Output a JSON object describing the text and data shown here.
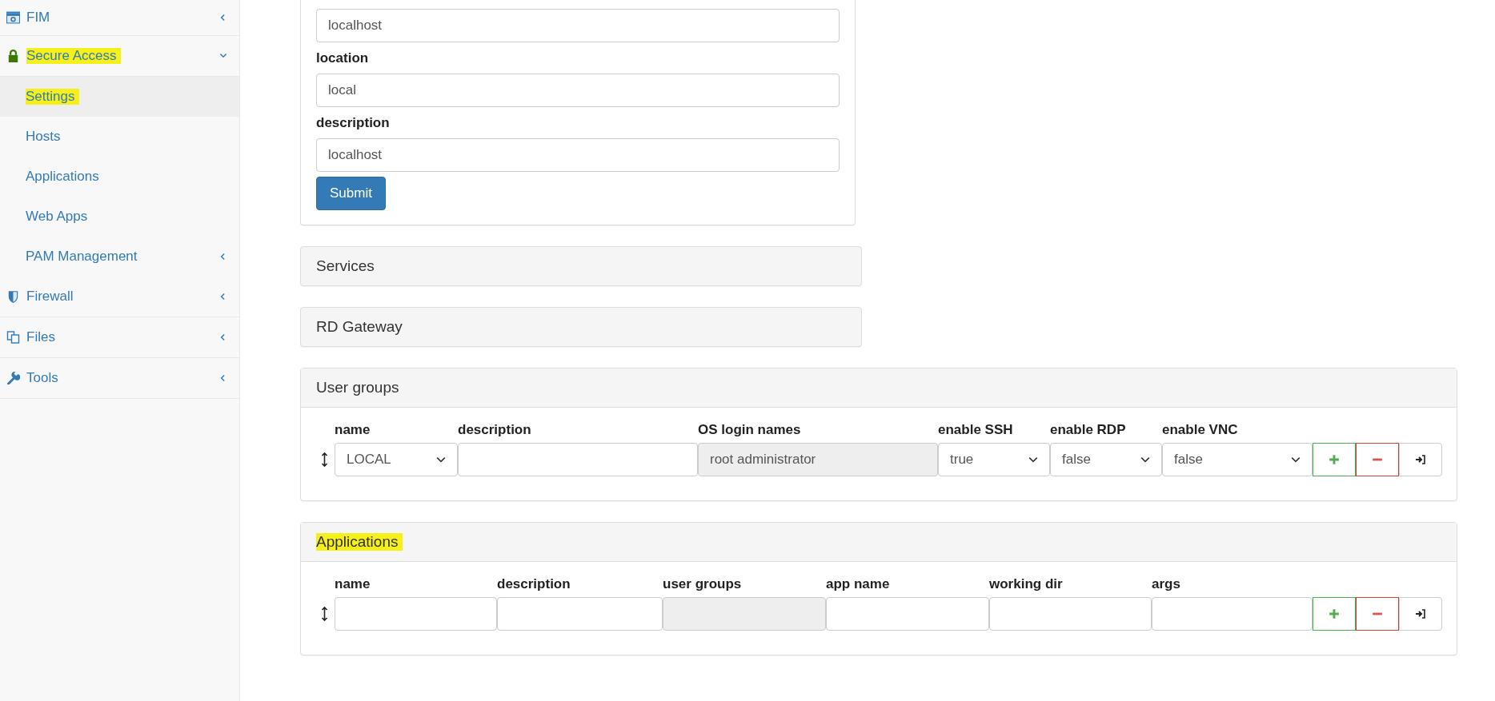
{
  "sidebar": {
    "items": [
      {
        "label": "FIM",
        "expanded": false,
        "highlighted": false
      },
      {
        "label": "Secure Access",
        "expanded": true,
        "highlighted": true,
        "children": [
          {
            "label": "Settings",
            "selected": true,
            "highlighted": true
          },
          {
            "label": "Hosts",
            "selected": false,
            "highlighted": false
          },
          {
            "label": "Applications",
            "selected": false,
            "highlighted": false
          },
          {
            "label": "Web Apps",
            "selected": false,
            "highlighted": false
          },
          {
            "label": "PAM Management",
            "selected": false,
            "highlighted": false,
            "expanded": false
          }
        ]
      },
      {
        "label": "Firewall",
        "expanded": false,
        "highlighted": false
      },
      {
        "label": "Files",
        "expanded": false,
        "highlighted": false
      },
      {
        "label": "Tools",
        "expanded": false,
        "highlighted": false
      }
    ]
  },
  "form": {
    "fields": [
      {
        "value": "localhost"
      },
      {
        "label": "location",
        "value": "local"
      },
      {
        "label": "description",
        "value": "localhost"
      }
    ],
    "submit_button": "Submit"
  },
  "collapsed_panels": [
    {
      "title": "Services",
      "highlighted": false
    },
    {
      "title": "RD Gateway",
      "highlighted": false
    }
  ],
  "table_panels": [
    {
      "title": "User groups",
      "highlighted": false,
      "columns": [
        "name",
        "description",
        "OS login names",
        "enable SSH",
        "enable RDP",
        "enable VNC"
      ],
      "cells": [
        {
          "kind": "select",
          "value": "LOCAL"
        },
        {
          "kind": "input"
        },
        {
          "kind": "readonly",
          "value": "root administrator"
        },
        {
          "kind": "select",
          "value": "true"
        },
        {
          "kind": "select",
          "value": "false"
        },
        {
          "kind": "select",
          "value": "false"
        }
      ]
    },
    {
      "title": "Applications",
      "highlighted": true,
      "columns": [
        "name",
        "description",
        "user groups",
        "app name",
        "working dir",
        "args"
      ],
      "cells": [
        {
          "kind": "input"
        },
        {
          "kind": "input"
        },
        {
          "kind": "readonly"
        },
        {
          "kind": "input"
        },
        {
          "kind": "input"
        },
        {
          "kind": "input"
        }
      ]
    }
  ]
}
